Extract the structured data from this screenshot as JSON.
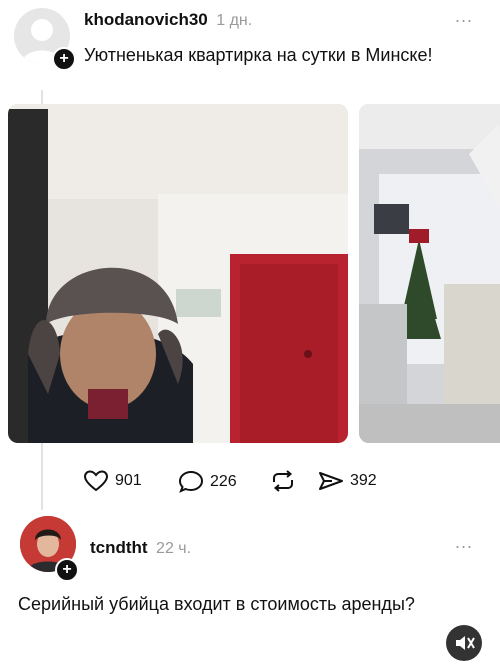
{
  "post": {
    "username": "khodanovich30",
    "time": "1 дн.",
    "more": "...",
    "text": "Уютненькая квартирка на сутки в Минске!",
    "plus": "+"
  },
  "actions": {
    "likes": "901",
    "comments": "226",
    "shares": "392"
  },
  "comment": {
    "username": "tcndtht",
    "time": "22 ч.",
    "more": "...",
    "text": "Серийный убийца входит в стоимость аренды?",
    "plus": "+"
  },
  "icons": [
    "heart-icon",
    "comment-bubble-icon",
    "repost-icon",
    "send-icon",
    "mute-icon"
  ],
  "colors": {
    "door": "#b8232f",
    "hat": "#5a5250",
    "tree": "#2f4a2a",
    "bow": "#a01c28"
  }
}
